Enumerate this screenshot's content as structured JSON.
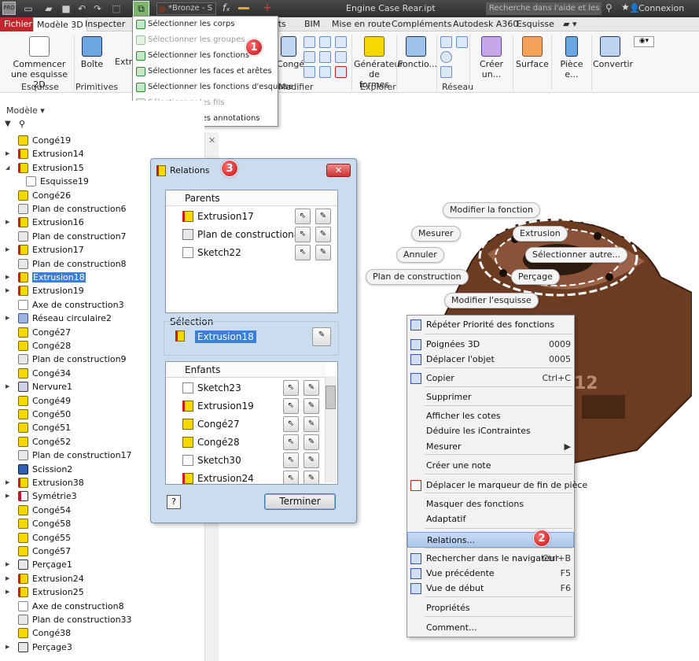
{
  "titlebar": {
    "app_logo": "PRO",
    "material": "*Bronze - S",
    "document_title": "Engine Case Rear.ipt",
    "help_search_placeholder": "Recherche dans l'aide et les com",
    "connexion": "Connexion",
    "fx_icon": "fx-icon"
  },
  "tabs": {
    "fichier": "Fichier",
    "modele3d": "Modèle 3D",
    "inspecter": "Inspecter",
    "environments": "ents",
    "bim": "BIM",
    "mise_en_route": "Mise en route",
    "complements": "Compléments",
    "a360": "Autodesk A360",
    "esquisse": "Esquisse"
  },
  "ribbon": {
    "commencer": "Commencer",
    "une_esquisse": "une esquisse 2D",
    "boite": "Boîte",
    "extru": "Extru",
    "conge": "Congé",
    "modifier": "Modifier",
    "generateur1": "Générateur",
    "generateur2": "de formes",
    "fonctio": "Fonctio...",
    "creer": "Créer un...",
    "surface": "Surface",
    "piece": "Pièce e...",
    "convertir": "Convertir",
    "groups": {
      "esquisse": "Esquisse",
      "primitives": "Primitives",
      "explorer": "Explorer",
      "reseau": "Réseau"
    }
  },
  "selection_filter_menu": {
    "items": [
      {
        "label": "Sélectionner les corps",
        "enabled": true
      },
      {
        "label": "Sélectionner les groupes",
        "enabled": false
      },
      {
        "label": "Sélectionner les fonctions",
        "enabled": true
      },
      {
        "label": "Sélectionner les faces et arêtes",
        "enabled": true
      },
      {
        "label": "Sélectionner les fonctions d'esquisse",
        "enabled": true
      },
      {
        "label": "Sélectionner les fils",
        "enabled": false
      },
      {
        "label": "Sélectionner les annotations",
        "enabled": true
      }
    ]
  },
  "badges": {
    "one": "1",
    "two": "2",
    "three": "3"
  },
  "browser": {
    "title": "Modèle",
    "tree": [
      {
        "label": "Congé19",
        "icon": "fillet",
        "expand": ""
      },
      {
        "label": "Extrusion14",
        "icon": "extrusion",
        "expand": "▶"
      },
      {
        "label": "Extrusion15",
        "icon": "extrusion",
        "expand": "◢"
      },
      {
        "label": "Esquisse19",
        "icon": "sketch",
        "expand": "",
        "indent": true
      },
      {
        "label": "Congé26",
        "icon": "fillet",
        "expand": ""
      },
      {
        "label": "Plan de construction6",
        "icon": "plane",
        "expand": ""
      },
      {
        "label": "Extrusion16",
        "icon": "extrusion",
        "expand": "▶"
      },
      {
        "label": "Plan de construction7",
        "icon": "plane",
        "expand": ""
      },
      {
        "label": "Extrusion17",
        "icon": "extrusion",
        "expand": "▶"
      },
      {
        "label": "Plan de construction8",
        "icon": "plane",
        "expand": ""
      },
      {
        "label": "Extrusion18",
        "icon": "extrusion",
        "expand": "▶",
        "selected": true
      },
      {
        "label": "Extrusion19",
        "icon": "extrusion",
        "expand": "▶"
      },
      {
        "label": "Axe de construction3",
        "icon": "axis",
        "expand": ""
      },
      {
        "label": "Réseau circulaire2",
        "icon": "pattern",
        "expand": "▶"
      },
      {
        "label": "Congé27",
        "icon": "fillet",
        "expand": ""
      },
      {
        "label": "Congé28",
        "icon": "fillet",
        "expand": ""
      },
      {
        "label": "Plan de construction9",
        "icon": "plane",
        "expand": ""
      },
      {
        "label": "Congé34",
        "icon": "fillet",
        "expand": ""
      },
      {
        "label": "Nervure1",
        "icon": "rib",
        "expand": "▶"
      },
      {
        "label": "Congé49",
        "icon": "fillet",
        "expand": ""
      },
      {
        "label": "Congé50",
        "icon": "fillet",
        "expand": ""
      },
      {
        "label": "Congé51",
        "icon": "fillet",
        "expand": ""
      },
      {
        "label": "Congé52",
        "icon": "fillet",
        "expand": ""
      },
      {
        "label": "Plan de construction17",
        "icon": "plane",
        "expand": ""
      },
      {
        "label": "Scission2",
        "icon": "split",
        "expand": ""
      },
      {
        "label": "Extrusion38",
        "icon": "extrusion",
        "expand": "▶"
      },
      {
        "label": "Symétrie3",
        "icon": "mirror",
        "expand": "▶"
      },
      {
        "label": "Congé54",
        "icon": "fillet",
        "expand": ""
      },
      {
        "label": "Congé58",
        "icon": "fillet",
        "expand": ""
      },
      {
        "label": "Congé55",
        "icon": "fillet",
        "expand": ""
      },
      {
        "label": "Congé57",
        "icon": "fillet",
        "expand": ""
      },
      {
        "label": "Perçage1",
        "icon": "hole",
        "expand": "▶"
      },
      {
        "label": "Extrusion24",
        "icon": "extrusion",
        "expand": "▶"
      },
      {
        "label": "Extrusion25",
        "icon": "extrusion",
        "expand": "▶"
      },
      {
        "label": "Axe de construction8",
        "icon": "axis",
        "expand": ""
      },
      {
        "label": "Plan de construction33",
        "icon": "plane",
        "expand": ""
      },
      {
        "label": "Congé38",
        "icon": "fillet",
        "expand": ""
      },
      {
        "label": "Perçage3",
        "icon": "hole",
        "expand": "▶"
      }
    ]
  },
  "relations": {
    "title": "Relations",
    "close": "✕",
    "parents_header": "Parents",
    "parents": [
      {
        "label": "Extrusion17",
        "icon": "extrusion"
      },
      {
        "label": "Plan de construction8",
        "icon": "plane"
      },
      {
        "label": "Sketch22",
        "icon": "sketch"
      }
    ],
    "selection_label": "Sélection",
    "selection_value": "Extrusion18",
    "children_header": "Enfants",
    "children": [
      {
        "label": "Sketch23",
        "icon": "sketch"
      },
      {
        "label": "Extrusion19",
        "icon": "extrusion"
      },
      {
        "label": "Congé27",
        "icon": "fillet"
      },
      {
        "label": "Congé28",
        "icon": "fillet"
      },
      {
        "label": "Sketch30",
        "icon": "sketch"
      },
      {
        "label": "Extrusion24",
        "icon": "extrusion"
      }
    ],
    "help": "?",
    "terminer": "Terminer"
  },
  "viewport": {
    "bubbles": {
      "modifier_fonction": "Modifier la fonction",
      "mesurer": "Mesurer",
      "extrusion": "Extrusion",
      "annuler": "Annuler",
      "selectionner_autre": "Sélectionner autre...",
      "plan_construction": "Plan de construction",
      "percage": "Perçage",
      "modifier_esquisse": "Modifier l'esquisse"
    },
    "part_number": "12"
  },
  "context_menu": {
    "items": [
      {
        "label": "Répéter Priorité des fonctions",
        "shortcut": ""
      },
      {
        "label": "Poignées 3D",
        "shortcut": "0009"
      },
      {
        "label": "Déplacer l'objet",
        "shortcut": "0005"
      },
      {
        "label": "Copier",
        "shortcut": "Ctrl+C"
      },
      {
        "label": "Supprimer",
        "shortcut": ""
      },
      {
        "label": "Afficher les cotes",
        "shortcut": ""
      },
      {
        "label": "Déduire les iContraintes",
        "shortcut": ""
      },
      {
        "label": "Mesurer",
        "shortcut": "▶"
      },
      {
        "label": "Créer une note",
        "shortcut": ""
      },
      {
        "label": "Déplacer le marqueur de fin de pièce",
        "shortcut": ""
      },
      {
        "label": "Masquer des fonctions",
        "shortcut": ""
      },
      {
        "label": "Adaptatif",
        "shortcut": ""
      },
      {
        "label": "Relations...",
        "shortcut": ""
      },
      {
        "label": "Rechercher dans le navigateur",
        "shortcut": "Ctrl+B"
      },
      {
        "label": "Vue précédente",
        "shortcut": "F5"
      },
      {
        "label": "Vue de début",
        "shortcut": "F6"
      },
      {
        "label": "Propriétés",
        "shortcut": ""
      },
      {
        "label": "Comment...",
        "shortcut": ""
      }
    ]
  }
}
